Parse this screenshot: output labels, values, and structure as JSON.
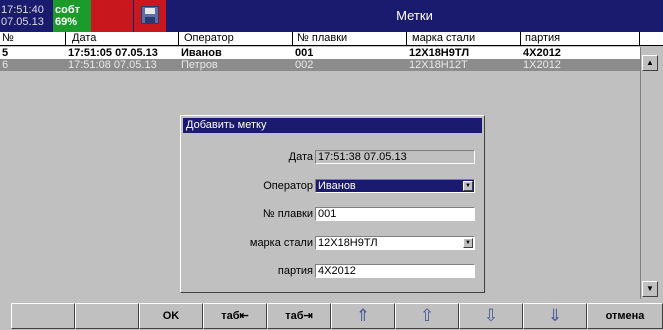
{
  "header": {
    "time": "17:51:40",
    "date": "07.05.13",
    "status_label": "собт",
    "status_value": "69%",
    "title": "Метки",
    "save_icon": "floppy-disk-icon"
  },
  "colors": {
    "titlebar": "#1a1a6e",
    "status_green": "#1b9c2a",
    "status_red": "#c8181e",
    "selected_row": "#8c8c8c"
  },
  "table": {
    "columns": [
      "№",
      "Дата",
      "Оператор",
      "№ плавки",
      "марка стали",
      "партия"
    ],
    "rows": [
      {
        "num": "5",
        "date": "17:51:05 07.05.13",
        "operator": "Иванов",
        "heat": "001",
        "steel": "12Х18Н9ТЛ",
        "batch": "4Х2012"
      },
      {
        "num": "6",
        "date": "17:51:08 07.05.13",
        "operator": "Петров",
        "heat": "002",
        "steel": "12Х18Н12Т",
        "batch": "1Х2012"
      }
    ]
  },
  "dialog": {
    "title": "Добавить метку",
    "fields": {
      "date_label": "Дата",
      "date_value": "17:51:38 07.05.13",
      "operator_label": "Оператор",
      "operator_value": "Иванов",
      "heat_label": "№ плавки",
      "heat_value": "001",
      "steel_label": "марка стали",
      "steel_value": "12Х18Н9ТЛ",
      "batch_label": "партия",
      "batch_value": "4Х2012"
    }
  },
  "toolbar": {
    "ok": "OK",
    "tab_back": "таб⇤",
    "tab_forward": "таб⇥",
    "page_up_icon": "double-arrow-up-icon",
    "up_icon": "arrow-up-icon",
    "down_icon": "arrow-down-icon",
    "page_down_icon": "double-arrow-down-icon",
    "cancel": "отмена"
  }
}
